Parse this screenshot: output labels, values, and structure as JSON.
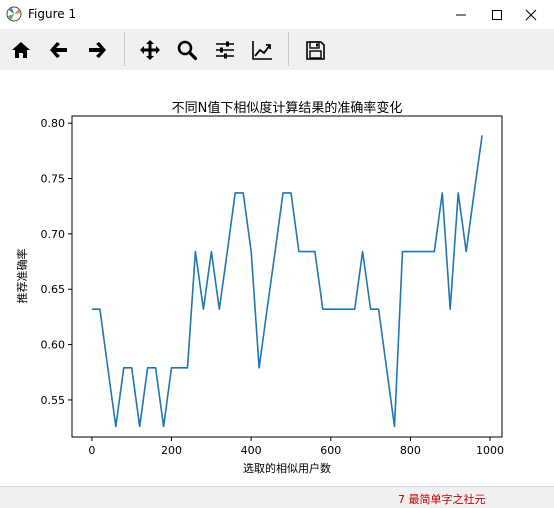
{
  "window": {
    "title": "Figure 1"
  },
  "toolbar": {
    "buttons": [
      {
        "name": "home-button",
        "icon": "home-icon"
      },
      {
        "name": "back-button",
        "icon": "arrow-left-icon"
      },
      {
        "name": "forward-button",
        "icon": "arrow-right-icon"
      },
      {
        "name": "pan-button",
        "icon": "move-icon"
      },
      {
        "name": "zoom-button",
        "icon": "magnifier-icon"
      },
      {
        "name": "configure-subplots-button",
        "icon": "sliders-icon"
      },
      {
        "name": "edit-axis-button",
        "icon": "line-chart-icon"
      },
      {
        "name": "save-button",
        "icon": "floppy-disk-icon"
      }
    ]
  },
  "status": {
    "text": "7 最简单字之社元"
  },
  "colors": {
    "line": "#1f77b4",
    "toolbar_bg": "#f0f0f0"
  },
  "chart_data": {
    "type": "line",
    "title": "不同N值下相似度计算结果的准确率变化",
    "xlabel": "选取的相似用户数",
    "ylabel": "推荐准确率",
    "xlim": [
      -50,
      1030
    ],
    "ylim": [
      0.5165,
      0.8065
    ],
    "xticks": [
      0,
      200,
      400,
      600,
      800,
      1000
    ],
    "yticks": [
      0.55,
      0.6,
      0.65,
      0.7,
      0.75,
      0.8
    ],
    "ytick_labels": [
      "0.55",
      "0.60",
      "0.65",
      "0.70",
      "0.75",
      "0.80"
    ],
    "x": [
      0,
      20,
      40,
      60,
      80,
      100,
      120,
      140,
      160,
      180,
      200,
      220,
      240,
      260,
      280,
      300,
      320,
      340,
      360,
      380,
      400,
      420,
      440,
      460,
      480,
      500,
      520,
      540,
      560,
      580,
      600,
      620,
      640,
      660,
      680,
      700,
      720,
      740,
      760,
      780,
      800,
      820,
      840,
      860,
      880,
      900,
      920,
      940,
      960,
      980
    ],
    "y": [
      0.632,
      0.632,
      0.579,
      0.526,
      0.579,
      0.579,
      0.526,
      0.579,
      0.579,
      0.526,
      0.579,
      0.579,
      0.579,
      0.684,
      0.632,
      0.684,
      0.632,
      0.684,
      0.737,
      0.737,
      0.684,
      0.579,
      0.632,
      0.684,
      0.737,
      0.737,
      0.684,
      0.684,
      0.684,
      0.632,
      0.632,
      0.632,
      0.632,
      0.632,
      0.684,
      0.632,
      0.632,
      0.579,
      0.526,
      0.684,
      0.684,
      0.684,
      0.684,
      0.684,
      0.737,
      0.632,
      0.737,
      0.684,
      0.737,
      0.789
    ],
    "grid": false
  }
}
